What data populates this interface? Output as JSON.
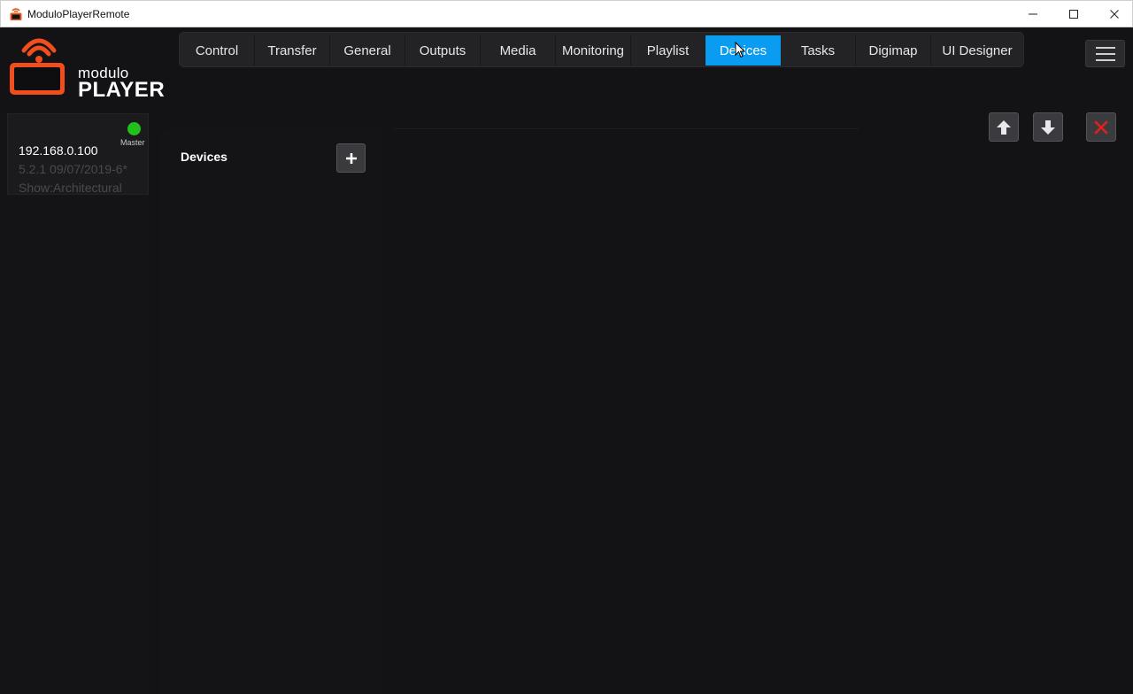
{
  "window": {
    "title": "ModuloPlayerRemote"
  },
  "logo": {
    "line1": "modulo",
    "line2": "PLAYER"
  },
  "tabs": [
    {
      "label": "Control"
    },
    {
      "label": "Transfer"
    },
    {
      "label": "General"
    },
    {
      "label": "Outputs"
    },
    {
      "label": "Media"
    },
    {
      "label": "Monitoring"
    },
    {
      "label": "Playlist"
    },
    {
      "label": "Devices",
      "active": true
    },
    {
      "label": "Tasks"
    },
    {
      "label": "Digimap"
    },
    {
      "label": "UI Designer"
    }
  ],
  "server": {
    "ip": "192.168.0.100",
    "version": "5.2.1 09/07/2019-6*",
    "show": "Show:Architectural",
    "role": "Master",
    "status_color": "#22c01a"
  },
  "devices_panel": {
    "title": "Devices"
  },
  "colors": {
    "accent": "#0a9cf0",
    "logo_orange": "#f04e1c",
    "delete_red": "#e0201c"
  }
}
